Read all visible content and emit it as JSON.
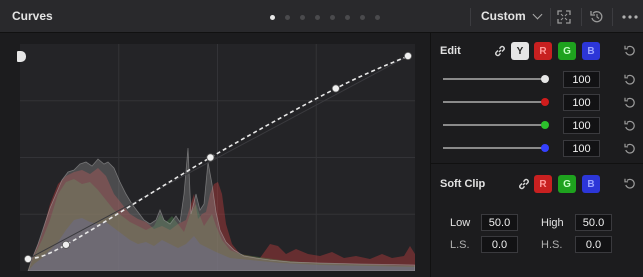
{
  "header": {
    "title": "Curves",
    "page_dots": 8,
    "active_dot": 0,
    "mode_label": "Custom",
    "icons": [
      "expand-icon",
      "reset-all-icon",
      "more-options-icon"
    ]
  },
  "editor": {
    "curve_points": [
      [
        0.0,
        0.0
      ],
      [
        0.1,
        0.07
      ],
      [
        0.48,
        0.5
      ],
      [
        0.81,
        0.84
      ],
      [
        1.0,
        1.0
      ]
    ]
  },
  "edit": {
    "label": "Edit",
    "channels": [
      "Y",
      "R",
      "G",
      "B"
    ],
    "sliders": [
      {
        "channel": "luma",
        "value": "100",
        "color": "#e6e6e6"
      },
      {
        "channel": "red",
        "value": "100",
        "color": "#d01c1c"
      },
      {
        "channel": "green",
        "value": "100",
        "color": "#2cc22c"
      },
      {
        "channel": "blue",
        "value": "100",
        "color": "#3440ff"
      }
    ]
  },
  "soft_clip": {
    "label": "Soft Clip",
    "channels": [
      "R",
      "G",
      "B"
    ],
    "low_label": "Low",
    "low_value": "50.0",
    "high_label": "High",
    "high_value": "50.0",
    "ls_label": "L.S.",
    "ls_value": "0.0",
    "hs_label": "H.S.",
    "hs_value": "0.0"
  },
  "colors": {
    "accent_red": "#c82020",
    "accent_green": "#1ea21e",
    "accent_blue": "#2c36d8"
  }
}
